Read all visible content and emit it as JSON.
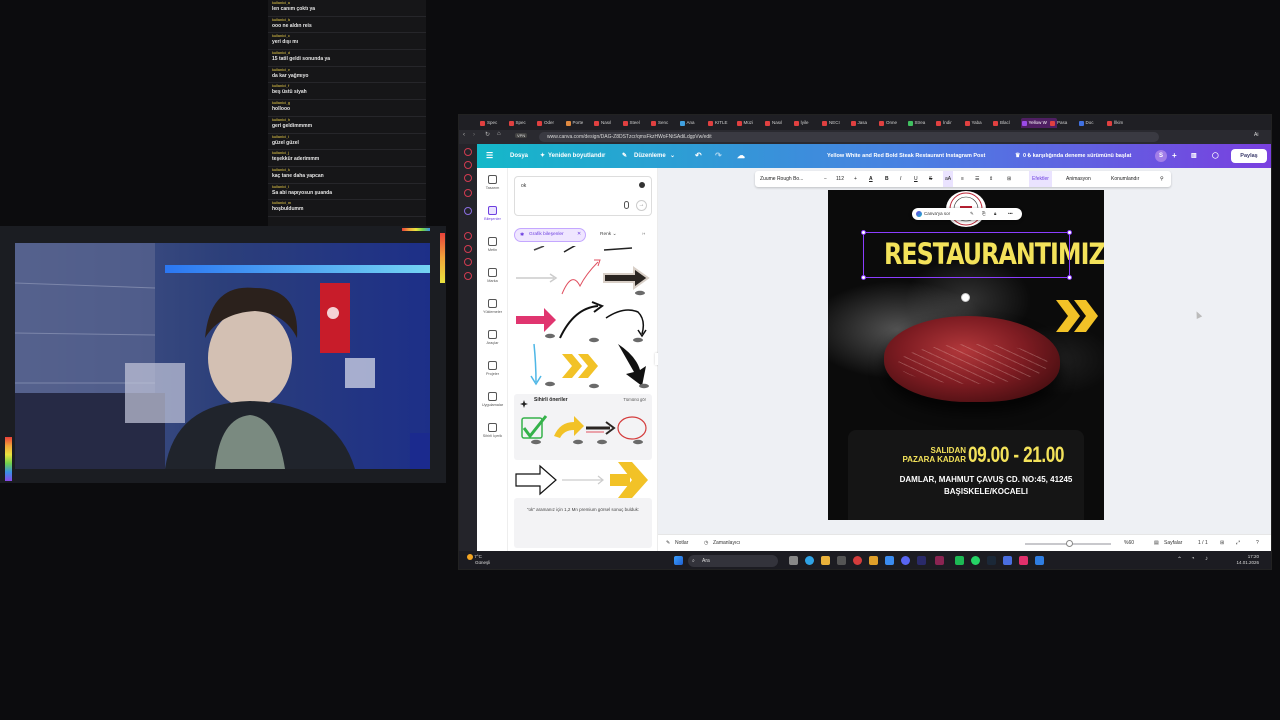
{
  "chat": {
    "messages": [
      {
        "user": "kullanici_a",
        "text": "len canım çoktı ya"
      },
      {
        "user": "kullanici_b",
        "text": "ooo ne aldın reis"
      },
      {
        "user": "kullanici_c",
        "text": "yeri dışı mı"
      },
      {
        "user": "kullanici_d",
        "text": "15 tatil geldi sonunda ya"
      },
      {
        "user": "kullanici_e",
        "text": "da kar yağmıyo"
      },
      {
        "user": "kullanici_f",
        "text": "beş üstü siyah"
      },
      {
        "user": "kullanici_g",
        "text": "hollooo"
      },
      {
        "user": "kullanici_h",
        "text": "geri geldimmmm"
      },
      {
        "user": "kullanici_i",
        "text": "güzel güzel"
      },
      {
        "user": "kullanici_j",
        "text": "teşekkür aderimmm"
      },
      {
        "user": "kullanici_k",
        "text": "kaç tane daha yapcan"
      },
      {
        "user": "kullanici_l",
        "text": "Sa abi napıyosun şuanda"
      },
      {
        "user": "kullanici_m",
        "text": "hoşbuldumm"
      }
    ]
  },
  "browser": {
    "tabs": [
      {
        "label": "Spec",
        "color": "#e04040"
      },
      {
        "label": "Spec",
        "color": "#e04040"
      },
      {
        "label": "Oder",
        "color": "#e04040"
      },
      {
        "label": "Porte",
        "color": "#e08a40"
      },
      {
        "label": "Nasıl",
        "color": "#e04040"
      },
      {
        "label": "Steel",
        "color": "#e04040"
      },
      {
        "label": "Senc",
        "color": "#e04040"
      },
      {
        "label": "Ana",
        "color": "#40a0e0"
      },
      {
        "label": "KITLE",
        "color": "#e04040"
      },
      {
        "label": "Müzi",
        "color": "#e04040"
      },
      {
        "label": "Nasıl",
        "color": "#e04040"
      },
      {
        "label": "İyile",
        "color": "#e04040"
      },
      {
        "label": "NECI",
        "color": "#e04040"
      },
      {
        "label": "Jasa",
        "color": "#e04040"
      },
      {
        "label": "Onne",
        "color": "#e04040"
      },
      {
        "label": "Strea",
        "color": "#40c060"
      },
      {
        "label": "İndir",
        "color": "#e04040"
      },
      {
        "label": "Yaba",
        "color": "#e04040"
      },
      {
        "label": "Blacl",
        "color": "#e04040"
      },
      {
        "label": "Yellow W",
        "color": "#9c4ae8"
      },
      {
        "label": "Pasa",
        "color": "#e04040"
      },
      {
        "label": "Doc",
        "color": "#4070e0"
      },
      {
        "label": "İlkim",
        "color": "#e04040"
      }
    ],
    "url": "www.canva.com/design/DAG-Z8DSTzcr/qmsFkzHWoFNtSAdiLdgpVw/edit",
    "vpn_label": "VPN",
    "ai_label": "Ai"
  },
  "canva": {
    "header": {
      "file_label": "Dosya",
      "resize_label": "Yeniden boyutlandır",
      "edit_label": "Düzenleme",
      "design_title": "Yellow White and Red Bold Steak Restaurant Instagram Post",
      "trial_label": "0 ₺ karşılığında deneme sürümünü başlat",
      "avatar_letter": "S",
      "share_label": "Paylaş"
    },
    "tools": [
      {
        "label": "Tasarım",
        "active": false
      },
      {
        "label": "Bileşenler",
        "active": true
      },
      {
        "label": "Metin",
        "active": false
      },
      {
        "label": "Marka",
        "active": false
      },
      {
        "label": "Yüklemeler",
        "active": false
      },
      {
        "label": "Araçlar",
        "active": false
      },
      {
        "label": "Projeler",
        "active": false
      },
      {
        "label": "Uygulamalar",
        "active": false
      },
      {
        "label": "Sihirli İçerik",
        "active": false
      }
    ],
    "panel": {
      "search_value": "ok",
      "filter_chip": "Grafik bileşenler",
      "color_filter": "Renk",
      "more_filter": "››",
      "magic_title": "Sihirli öneriler",
      "magic_all": "Tümünü gör",
      "premium_note": "\"ok\" aramanız için 1,2 Mn premium görsel sonuç bulduk:"
    },
    "format_toolbar": {
      "font": "Zuume Rough Bo...",
      "minus": "−",
      "size": "112",
      "plus": "+",
      "effects": "Efektler",
      "animate": "Animasyon",
      "position": "Konumlandır"
    },
    "poster": {
      "title": "RESTAURANTIMIZ",
      "open_label": "SALIDAN PAZARA KADAR",
      "hours": "09.00 - 21.00",
      "address": "DAMLAR, MAHMUT ÇAVUŞ CD. NO:45, 41245 BAŞISKELE/KOCAELI",
      "ask_canva": "Canva'ya sor",
      "accent": "#f3e25a"
    },
    "bottom_bar": {
      "notes": "Notlar",
      "timer": "Zamanlayıcı",
      "zoom": "%60",
      "pages_label": "Sayfalar",
      "page_count": "1 / 1"
    }
  },
  "taskbar": {
    "temperature": "7°C",
    "weather": "Güneşli",
    "search_placeholder": "Ara",
    "time": "17:20",
    "date": "14.01.2026"
  }
}
